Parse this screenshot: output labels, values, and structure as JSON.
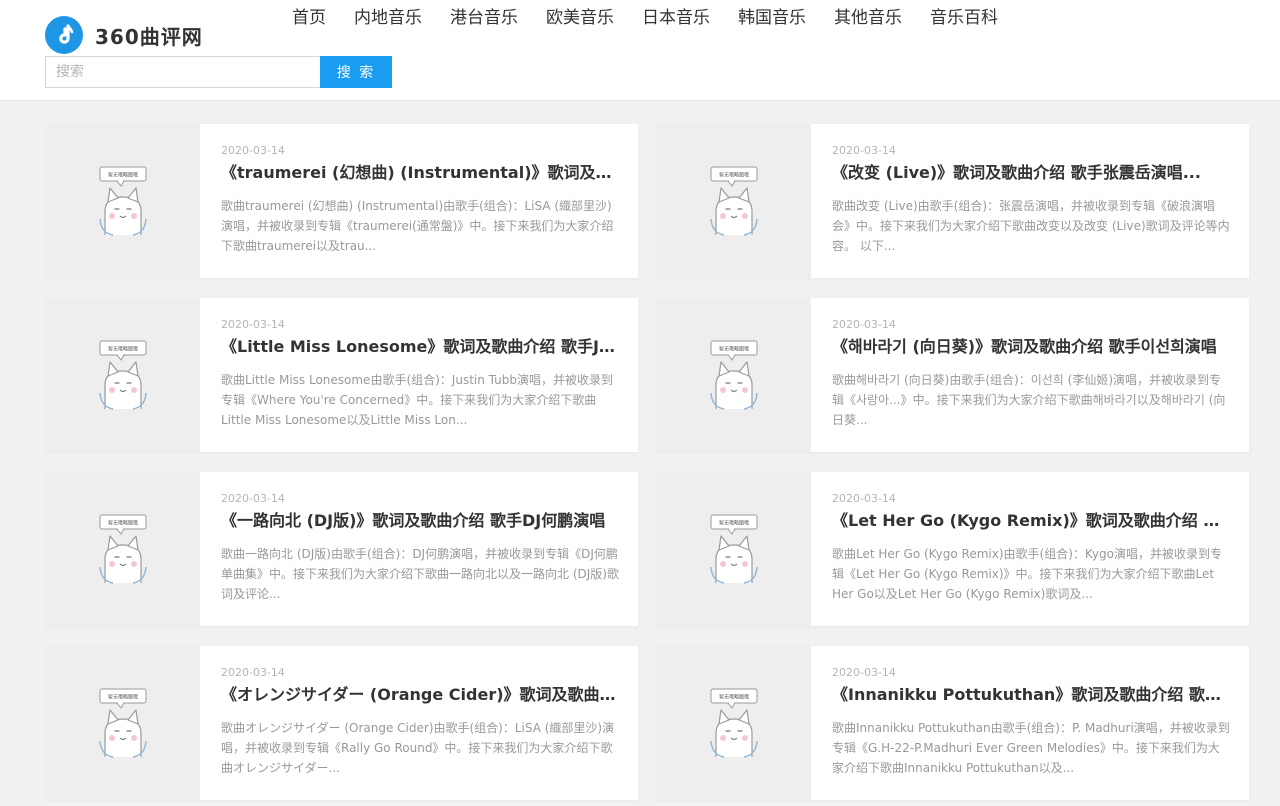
{
  "site": {
    "name": "360曲评网"
  },
  "nav": [
    "首页",
    "内地音乐",
    "港台音乐",
    "欧美音乐",
    "日本音乐",
    "韩国音乐",
    "其他音乐",
    "音乐百科"
  ],
  "search": {
    "placeholder": "搜索",
    "button": "搜 索"
  },
  "placeholder_image": {
    "label": "暂无哦略图哦"
  },
  "articles": [
    {
      "date": "2020-03-14",
      "title": "《traumerei (幻想曲) (Instrumental)》歌词及歌曲介绍 歌手LiSA演唱",
      "desc": "歌曲traumerei (幻想曲) (Instrumental)由歌手(组合)：LiSA (織部里沙)演唱，并被收录到专辑《traumerei(通常盤)》中。接下来我们为大家介绍下歌曲traumerei以及trau..."
    },
    {
      "date": "2020-03-14",
      "title": "《改变 (Live)》歌词及歌曲介绍 歌手张震岳演唱...",
      "desc": "歌曲改变 (Live)由歌手(组合)：张震岳演唱，并被收录到专辑《破浪演唱会》中。接下来我们为大家介绍下歌曲改变以及改变 (Live)歌词及评论等内容。 以下..."
    },
    {
      "date": "2020-03-14",
      "title": "《Little Miss Lonesome》歌词及歌曲介绍 歌手Justin Tubb演唱",
      "desc": "歌曲Little Miss Lonesome由歌手(组合)：Justin Tubb演唱，并被收录到专辑《Where You're Concerned》中。接下来我们为大家介绍下歌曲Little Miss Lonesome以及Little Miss Lon..."
    },
    {
      "date": "2020-03-14",
      "title": "《해바라기 (向日葵)》歌词及歌曲介绍 歌手이선희演唱",
      "desc": "歌曲해바라기 (向日葵)由歌手(组合)：이선희 (李仙姬)演唱，并被收录到专辑《사랑아...》中。接下来我们为大家介绍下歌曲해바라기以及해바라기 (向日葵..."
    },
    {
      "date": "2020-03-14",
      "title": "《一路向北 (DJ版)》歌词及歌曲介绍 歌手DJ何鹏演唱",
      "desc": "歌曲一路向北 (DJ版)由歌手(组合)：DJ何鹏演唱，并被收录到专辑《DJ何鹏单曲集》中。接下来我们为大家介绍下歌曲一路向北以及一路向北 (DJ版)歌词及评论..."
    },
    {
      "date": "2020-03-14",
      "title": "《Let Her Go (Kygo Remix)》歌词及歌曲介绍 歌手Kygo演唱",
      "desc": "歌曲Let Her Go (Kygo Remix)由歌手(组合)：Kygo演唱，并被收录到专辑《Let Her Go (Kygo Remix)》中。接下来我们为大家介绍下歌曲Let Her Go以及Let Her Go (Kygo Remix)歌词及..."
    },
    {
      "date": "2020-03-14",
      "title": "《オレンジサイダー (Orange Cider)》歌词及歌曲介绍 歌手LiSA演唱",
      "desc": "歌曲オレンジサイダー (Orange Cider)由歌手(组合)：LiSA (織部里沙)演唱，并被收录到专辑《Rally Go Round》中。接下来我们为大家介绍下歌曲オレンジサイダー..."
    },
    {
      "date": "2020-03-14",
      "title": "《Innanikku Pottukuthan》歌词及歌曲介绍 歌手P. Madhuri演唱",
      "desc": "歌曲Innanikku Pottukuthan由歌手(组合)：P. Madhuri演唱，并被收录到专辑《G.H-22-P.Madhuri Ever Green Melodies》中。接下来我们为大家介绍下歌曲Innanikku Pottukuthan以及..."
    }
  ]
}
